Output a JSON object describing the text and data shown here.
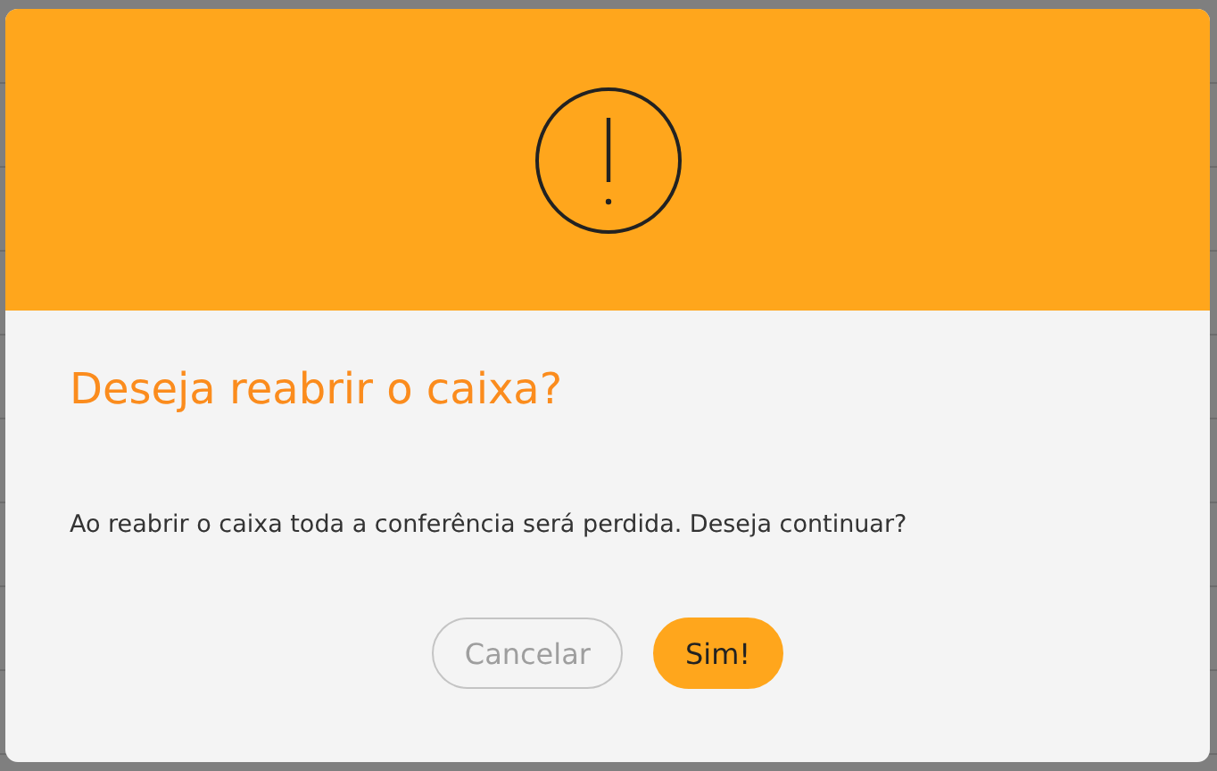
{
  "dialog": {
    "title": "Deseja reabrir o caixa?",
    "message": "Ao reabrir o caixa toda a conferência será perdida. Deseja continuar?",
    "buttons": [
      {
        "label": "Cancelar",
        "kind": "cancel"
      },
      {
        "label": "Sim!",
        "kind": "confirm"
      }
    ]
  }
}
